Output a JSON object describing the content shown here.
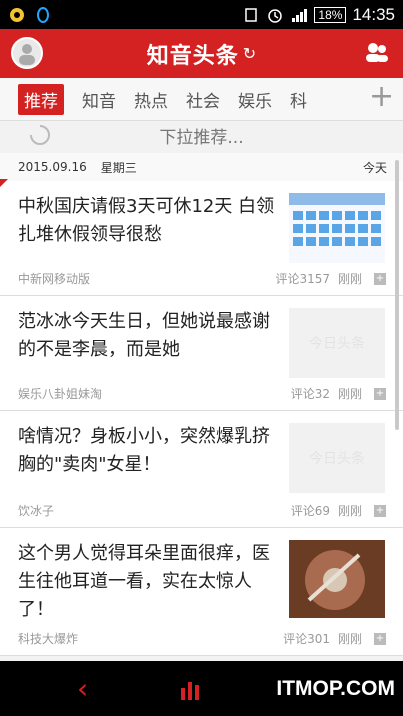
{
  "status_bar": {
    "time": "14:35",
    "battery": "18%"
  },
  "app_bar": {
    "title": "知音头条"
  },
  "tabs": [
    {
      "label": "推荐"
    },
    {
      "label": "知音"
    },
    {
      "label": "热点"
    },
    {
      "label": "社会"
    },
    {
      "label": "娱乐"
    },
    {
      "label": "科"
    }
  ],
  "pull_refresh": {
    "text": "下拉推荐..."
  },
  "date_row": {
    "date": "2015.09.16",
    "weekday": "星期三",
    "today": "今天"
  },
  "news": [
    {
      "title": "中秋国庆请假3天可休12天 白领扎堆休假领导很愁",
      "source": "中新网移动版",
      "comments": "评论3157",
      "time": "刚刚",
      "thumb_text": ""
    },
    {
      "title": "范冰冰今天生日，但她说最感谢的不是李晨，而是她",
      "source": "娱乐八卦姐妹淘",
      "comments": "评论32",
      "time": "刚刚",
      "thumb_text": "今日头条"
    },
    {
      "title": "啥情况？身板小小，突然爆乳挤胸的\"卖肉\"女星！",
      "source": "饮冰子",
      "comments": "评论69",
      "time": "刚刚",
      "thumb_text": "今日头条"
    },
    {
      "title": "这个男人觉得耳朵里面很痒，医生往他耳道一看，实在太惊人了！",
      "source": "科技大爆炸",
      "comments": "评论301",
      "time": "刚刚",
      "thumb_text": ""
    }
  ],
  "watermark": "ITMOP.COM"
}
